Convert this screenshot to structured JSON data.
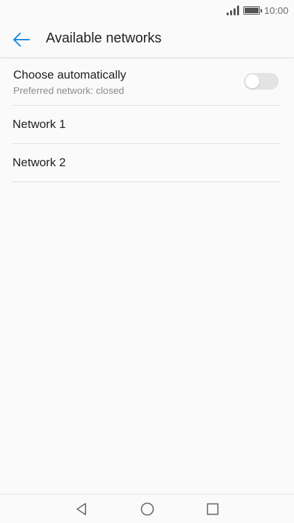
{
  "status_bar": {
    "time": "10:00",
    "icons": [
      "signal-icon",
      "battery-icon"
    ]
  },
  "app_bar": {
    "back_icon": "arrow-left-icon",
    "title": "Available networks",
    "accent_color": "#1a8cde"
  },
  "auto_select": {
    "title": "Choose automatically",
    "subtitle": "Preferred network: closed",
    "toggle_on": false
  },
  "networks": [
    {
      "label": "Network 1"
    },
    {
      "label": "Network 2"
    }
  ],
  "nav_bar": {
    "icons": [
      "back-triangle-icon",
      "home-circle-icon",
      "recents-square-icon"
    ]
  }
}
